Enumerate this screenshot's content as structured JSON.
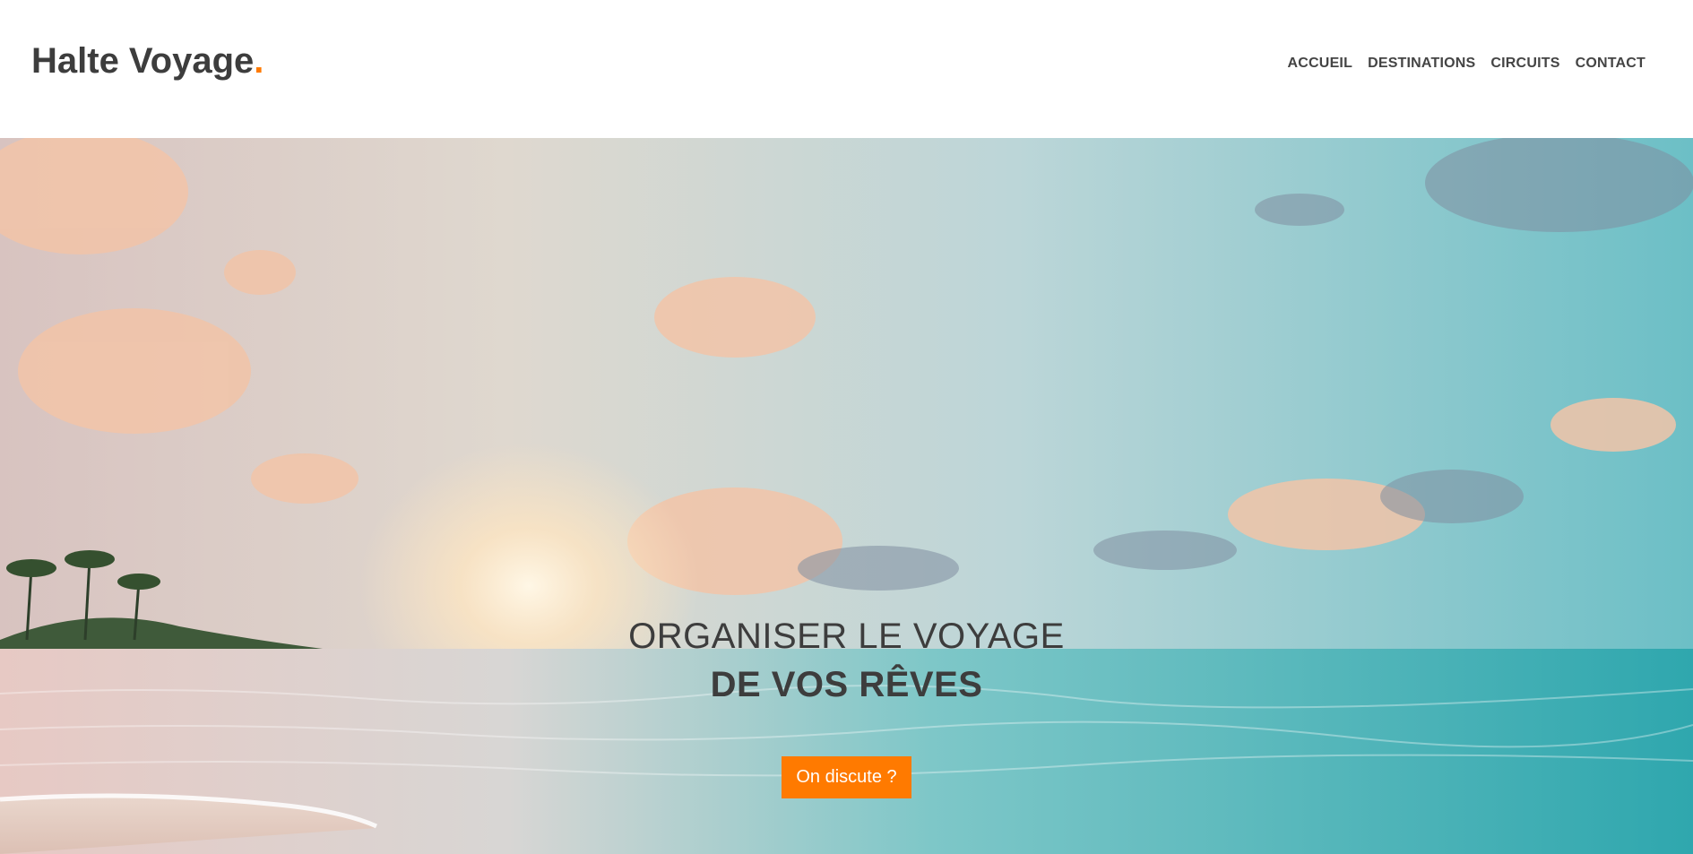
{
  "brand": {
    "name": "Halte Voyage",
    "dot": ".",
    "accent_color": "#ff7a00"
  },
  "nav": {
    "items": [
      {
        "label": "ACCUEIL"
      },
      {
        "label": "DESTINATIONS"
      },
      {
        "label": "CIRCUITS"
      },
      {
        "label": "CONTACT"
      }
    ]
  },
  "hero": {
    "line1": "ORGANISER LE VOYAGE",
    "line2": "DE VOS RÊVES",
    "cta_label": "On discute ?"
  }
}
